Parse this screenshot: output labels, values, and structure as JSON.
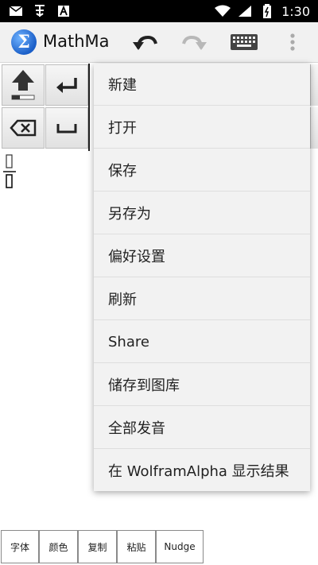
{
  "status_bar": {
    "time": "1:30",
    "left_icons": [
      "mail-icon",
      "notification-icon",
      "a-icon"
    ],
    "right_icons": [
      "wifi-icon",
      "signal-icon",
      "battery-icon"
    ]
  },
  "app_bar": {
    "title": "MathMa",
    "logo_glyph": "Σ",
    "undo_icon": "undo-icon",
    "redo_icon": "redo-icon",
    "keyboard_icon": "keyboard-icon",
    "overflow_icon": "more-vert-icon"
  },
  "keypad": {
    "keys": [
      {
        "name": "shift-key",
        "icon": "shift-up-icon"
      },
      {
        "name": "enter-key",
        "icon": "enter-icon"
      },
      {
        "name": "backspace-key",
        "icon": "backspace-icon"
      },
      {
        "name": "space-key",
        "icon": "space-icon"
      }
    ]
  },
  "menu": {
    "items": [
      {
        "label": "新建"
      },
      {
        "label": "打开"
      },
      {
        "label": "保存"
      },
      {
        "label": "另存为"
      },
      {
        "label": "偏好设置"
      },
      {
        "label": "刷新"
      },
      {
        "label": "Share"
      },
      {
        "label": "储存到图库"
      },
      {
        "label": "全部发音"
      },
      {
        "label": "在 WolframAlpha 显示结果"
      }
    ]
  },
  "bottom_toolbar": {
    "buttons": [
      {
        "label": "字体"
      },
      {
        "label": "颜色"
      },
      {
        "label": "复制"
      },
      {
        "label": "粘贴"
      },
      {
        "label": "Nudge"
      }
    ]
  },
  "colors": {
    "status_bar_bg": "#000000",
    "app_bar_bg": "#f1f1f1",
    "menu_bg": "#f2f2f2",
    "logo_blue": "#1b5fc8"
  }
}
